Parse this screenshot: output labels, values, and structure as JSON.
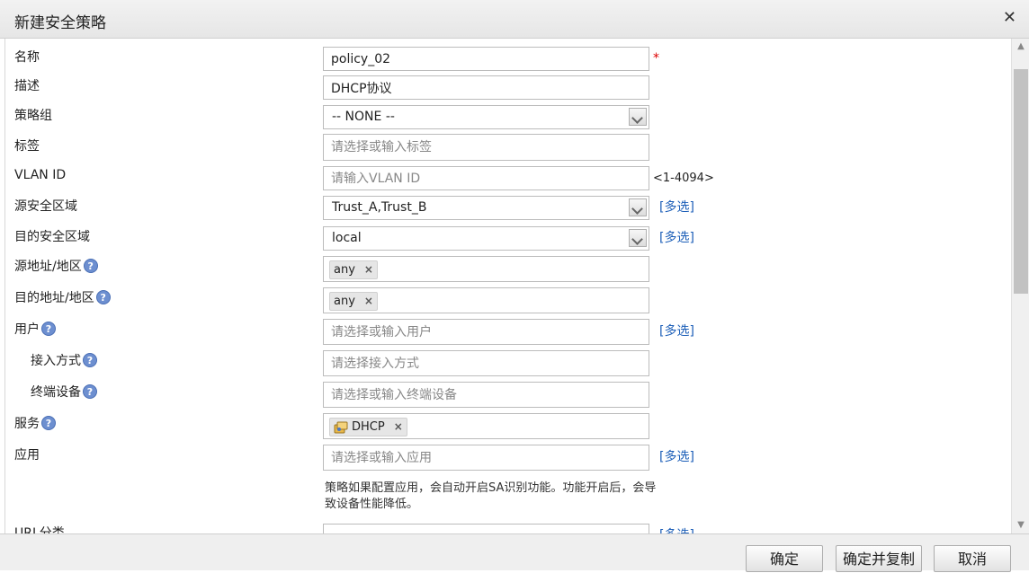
{
  "dialog": {
    "title": "新建安全策略",
    "close_icon": "close-icon"
  },
  "form": {
    "name": {
      "label": "名称",
      "value": "policy_02",
      "required_mark": "*"
    },
    "description": {
      "label": "描述",
      "value": "DHCP协议"
    },
    "policy_group": {
      "label": "策略组",
      "value": "-- NONE --"
    },
    "tag": {
      "label": "标签",
      "placeholder": "请选择或输入标签"
    },
    "vlan": {
      "label": "VLAN ID",
      "placeholder": "请输入VLAN ID",
      "range_hint": "<1-4094>"
    },
    "src_zone": {
      "label": "源安全区域",
      "value": "Trust_A,Trust_B",
      "multi": "[多选]"
    },
    "dst_zone": {
      "label": "目的安全区域",
      "value": "local",
      "multi": "[多选]"
    },
    "src_addr": {
      "label": "源地址/地区",
      "help": "?",
      "tag": "any"
    },
    "dst_addr": {
      "label": "目的地址/地区",
      "help": "?",
      "tag": "any"
    },
    "user": {
      "label": "用户",
      "help": "?",
      "placeholder": "请选择或输入用户",
      "multi": "[多选]"
    },
    "access_mode": {
      "label": "接入方式",
      "help": "?",
      "placeholder": "请选择接入方式"
    },
    "terminal_device": {
      "label": "终端设备",
      "help": "?",
      "placeholder": "请选择或输入终端设备"
    },
    "service": {
      "label": "服务",
      "help": "?",
      "tag": "DHCP",
      "icon": "service-icon"
    },
    "application": {
      "label": "应用",
      "placeholder": "请选择或输入应用",
      "multi": "[多选]",
      "note": "策略如果配置应用，会自动开启SA识别功能。功能开启后，会导致设备性能降低。"
    },
    "url_category": {
      "label": "URL分类",
      "multi": "[多选]"
    },
    "remove_icon": "×"
  },
  "footer": {
    "ok": "确定",
    "ok_copy": "确定并复制",
    "cancel": "取消"
  }
}
